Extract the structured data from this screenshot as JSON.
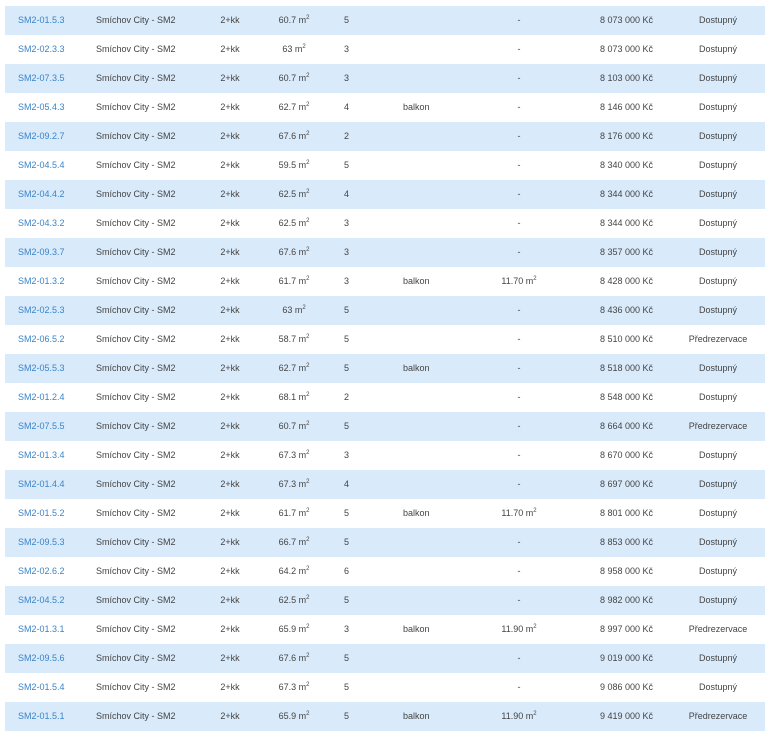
{
  "rows": [
    {
      "id": "SM2-01.5.3",
      "project": "Smíchov City - SM2",
      "layout": "2+kk",
      "area": "60.7 m",
      "area_unit_sup": "2",
      "floor": "5",
      "outdoor": "",
      "outdoor_area": "-",
      "outdoor_area_unit_sup": "",
      "price": "8 073 000 Kč",
      "status": "Dostupný"
    },
    {
      "id": "SM2-02.3.3",
      "project": "Smíchov City - SM2",
      "layout": "2+kk",
      "area": "63 m",
      "area_unit_sup": "2",
      "floor": "3",
      "outdoor": "",
      "outdoor_area": "-",
      "outdoor_area_unit_sup": "",
      "price": "8 073 000 Kč",
      "status": "Dostupný"
    },
    {
      "id": "SM2-07.3.5",
      "project": "Smíchov City - SM2",
      "layout": "2+kk",
      "area": "60.7 m",
      "area_unit_sup": "2",
      "floor": "3",
      "outdoor": "",
      "outdoor_area": "-",
      "outdoor_area_unit_sup": "",
      "price": "8 103 000 Kč",
      "status": "Dostupný"
    },
    {
      "id": "SM2-05.4.3",
      "project": "Smíchov City - SM2",
      "layout": "2+kk",
      "area": "62.7 m",
      "area_unit_sup": "2",
      "floor": "4",
      "outdoor": "balkon",
      "outdoor_area": "-",
      "outdoor_area_unit_sup": "",
      "price": "8 146 000 Kč",
      "status": "Dostupný"
    },
    {
      "id": "SM2-09.2.7",
      "project": "Smíchov City - SM2",
      "layout": "2+kk",
      "area": "67.6 m",
      "area_unit_sup": "2",
      "floor": "2",
      "outdoor": "",
      "outdoor_area": "-",
      "outdoor_area_unit_sup": "",
      "price": "8 176 000 Kč",
      "status": "Dostupný"
    },
    {
      "id": "SM2-04.5.4",
      "project": "Smíchov City - SM2",
      "layout": "2+kk",
      "area": "59.5 m",
      "area_unit_sup": "2",
      "floor": "5",
      "outdoor": "",
      "outdoor_area": "-",
      "outdoor_area_unit_sup": "",
      "price": "8 340 000 Kč",
      "status": "Dostupný"
    },
    {
      "id": "SM2-04.4.2",
      "project": "Smíchov City - SM2",
      "layout": "2+kk",
      "area": "62.5 m",
      "area_unit_sup": "2",
      "floor": "4",
      "outdoor": "",
      "outdoor_area": "-",
      "outdoor_area_unit_sup": "",
      "price": "8 344 000 Kč",
      "status": "Dostupný"
    },
    {
      "id": "SM2-04.3.2",
      "project": "Smíchov City - SM2",
      "layout": "2+kk",
      "area": "62.5 m",
      "area_unit_sup": "2",
      "floor": "3",
      "outdoor": "",
      "outdoor_area": "-",
      "outdoor_area_unit_sup": "",
      "price": "8 344 000 Kč",
      "status": "Dostupný"
    },
    {
      "id": "SM2-09.3.7",
      "project": "Smíchov City - SM2",
      "layout": "2+kk",
      "area": "67.6 m",
      "area_unit_sup": "2",
      "floor": "3",
      "outdoor": "",
      "outdoor_area": "-",
      "outdoor_area_unit_sup": "",
      "price": "8 357 000 Kč",
      "status": "Dostupný"
    },
    {
      "id": "SM2-01.3.2",
      "project": "Smíchov City - SM2",
      "layout": "2+kk",
      "area": "61.7 m",
      "area_unit_sup": "2",
      "floor": "3",
      "outdoor": "balkon",
      "outdoor_area": "11.70 m",
      "outdoor_area_unit_sup": "2",
      "price": "8 428 000 Kč",
      "status": "Dostupný"
    },
    {
      "id": "SM2-02.5.3",
      "project": "Smíchov City - SM2",
      "layout": "2+kk",
      "area": "63 m",
      "area_unit_sup": "2",
      "floor": "5",
      "outdoor": "",
      "outdoor_area": "-",
      "outdoor_area_unit_sup": "",
      "price": "8 436 000 Kč",
      "status": "Dostupný"
    },
    {
      "id": "SM2-06.5.2",
      "project": "Smíchov City - SM2",
      "layout": "2+kk",
      "area": "58.7 m",
      "area_unit_sup": "2",
      "floor": "5",
      "outdoor": "",
      "outdoor_area": "-",
      "outdoor_area_unit_sup": "",
      "price": "8 510 000 Kč",
      "status": "Předrezervace"
    },
    {
      "id": "SM2-05.5.3",
      "project": "Smíchov City - SM2",
      "layout": "2+kk",
      "area": "62.7 m",
      "area_unit_sup": "2",
      "floor": "5",
      "outdoor": "balkon",
      "outdoor_area": "-",
      "outdoor_area_unit_sup": "",
      "price": "8 518 000 Kč",
      "status": "Dostupný"
    },
    {
      "id": "SM2-01.2.4",
      "project": "Smíchov City - SM2",
      "layout": "2+kk",
      "area": "68.1 m",
      "area_unit_sup": "2",
      "floor": "2",
      "outdoor": "",
      "outdoor_area": "-",
      "outdoor_area_unit_sup": "",
      "price": "8 548 000 Kč",
      "status": "Dostupný"
    },
    {
      "id": "SM2-07.5.5",
      "project": "Smíchov City - SM2",
      "layout": "2+kk",
      "area": "60.7 m",
      "area_unit_sup": "2",
      "floor": "5",
      "outdoor": "",
      "outdoor_area": "-",
      "outdoor_area_unit_sup": "",
      "price": "8 664 000 Kč",
      "status": "Předrezervace"
    },
    {
      "id": "SM2-01.3.4",
      "project": "Smíchov City - SM2",
      "layout": "2+kk",
      "area": "67.3 m",
      "area_unit_sup": "2",
      "floor": "3",
      "outdoor": "",
      "outdoor_area": "-",
      "outdoor_area_unit_sup": "",
      "price": "8 670 000 Kč",
      "status": "Dostupný"
    },
    {
      "id": "SM2-01.4.4",
      "project": "Smíchov City - SM2",
      "layout": "2+kk",
      "area": "67.3 m",
      "area_unit_sup": "2",
      "floor": "4",
      "outdoor": "",
      "outdoor_area": "-",
      "outdoor_area_unit_sup": "",
      "price": "8 697 000 Kč",
      "status": "Dostupný"
    },
    {
      "id": "SM2-01.5.2",
      "project": "Smíchov City - SM2",
      "layout": "2+kk",
      "area": "61.7 m",
      "area_unit_sup": "2",
      "floor": "5",
      "outdoor": "balkon",
      "outdoor_area": "11.70 m",
      "outdoor_area_unit_sup": "2",
      "price": "8 801 000 Kč",
      "status": "Dostupný"
    },
    {
      "id": "SM2-09.5.3",
      "project": "Smíchov City - SM2",
      "layout": "2+kk",
      "area": "66.7 m",
      "area_unit_sup": "2",
      "floor": "5",
      "outdoor": "",
      "outdoor_area": "-",
      "outdoor_area_unit_sup": "",
      "price": "8 853 000 Kč",
      "status": "Dostupný"
    },
    {
      "id": "SM2-02.6.2",
      "project": "Smíchov City - SM2",
      "layout": "2+kk",
      "area": "64.2 m",
      "area_unit_sup": "2",
      "floor": "6",
      "outdoor": "",
      "outdoor_area": "-",
      "outdoor_area_unit_sup": "",
      "price": "8 958 000 Kč",
      "status": "Dostupný"
    },
    {
      "id": "SM2-04.5.2",
      "project": "Smíchov City - SM2",
      "layout": "2+kk",
      "area": "62.5 m",
      "area_unit_sup": "2",
      "floor": "5",
      "outdoor": "",
      "outdoor_area": "-",
      "outdoor_area_unit_sup": "",
      "price": "8 982 000 Kč",
      "status": "Dostupný"
    },
    {
      "id": "SM2-01.3.1",
      "project": "Smíchov City - SM2",
      "layout": "2+kk",
      "area": "65.9 m",
      "area_unit_sup": "2",
      "floor": "3",
      "outdoor": "balkon",
      "outdoor_area": "11.90 m",
      "outdoor_area_unit_sup": "2",
      "price": "8 997 000 Kč",
      "status": "Předrezervace"
    },
    {
      "id": "SM2-09.5.6",
      "project": "Smíchov City - SM2",
      "layout": "2+kk",
      "area": "67.6 m",
      "area_unit_sup": "2",
      "floor": "5",
      "outdoor": "",
      "outdoor_area": "-",
      "outdoor_area_unit_sup": "",
      "price": "9 019 000 Kč",
      "status": "Dostupný"
    },
    {
      "id": "SM2-01.5.4",
      "project": "Smíchov City - SM2",
      "layout": "2+kk",
      "area": "67.3 m",
      "area_unit_sup": "2",
      "floor": "5",
      "outdoor": "",
      "outdoor_area": "-",
      "outdoor_area_unit_sup": "",
      "price": "9 086 000 Kč",
      "status": "Dostupný"
    },
    {
      "id": "SM2-01.5.1",
      "project": "Smíchov City - SM2",
      "layout": "2+kk",
      "area": "65.9 m",
      "area_unit_sup": "2",
      "floor": "5",
      "outdoor": "balkon",
      "outdoor_area": "11.90 m",
      "outdoor_area_unit_sup": "2",
      "price": "9 419 000 Kč",
      "status": "Předrezervace"
    }
  ],
  "colors": {
    "row_stripe": "#d9eafb",
    "link": "#3a84c9",
    "text": "#444444"
  }
}
